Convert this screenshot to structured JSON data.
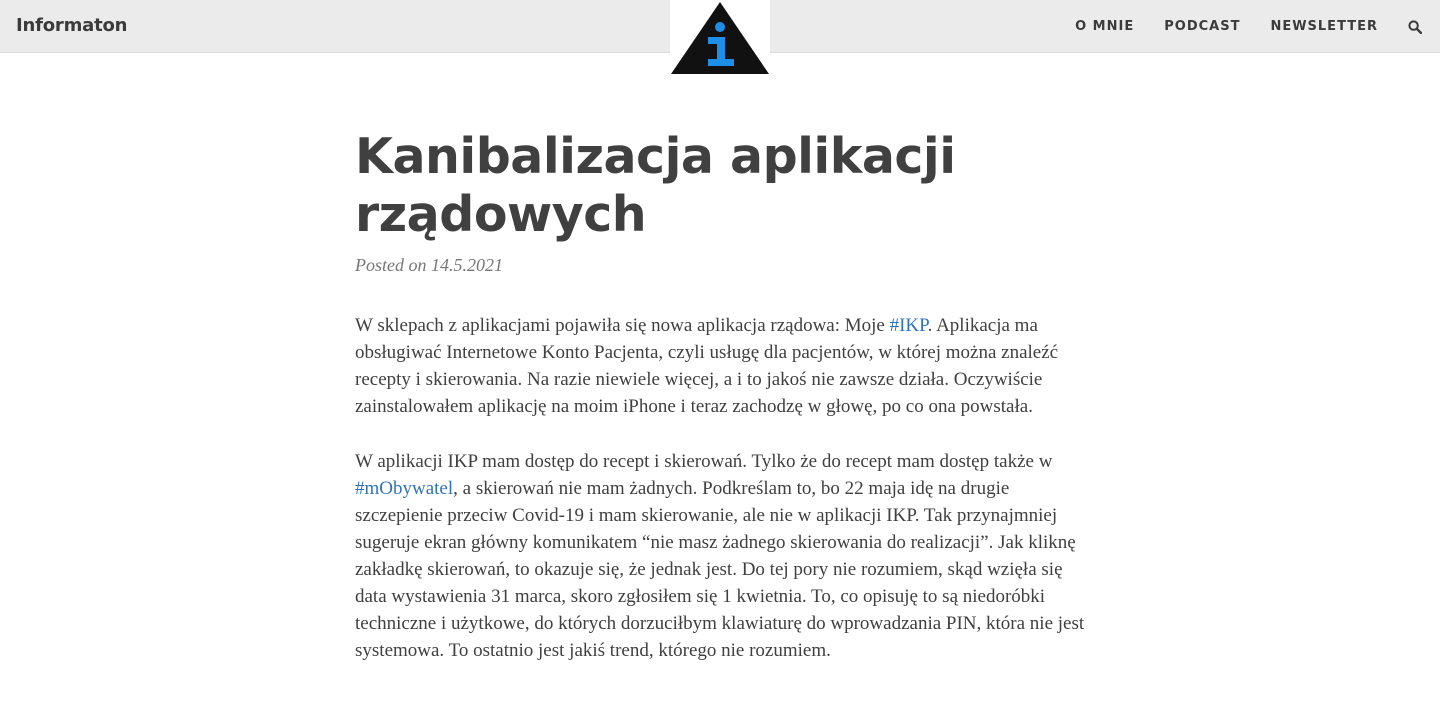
{
  "site": {
    "title": "Informaton"
  },
  "nav": {
    "items": [
      "O MNIE",
      "PODCAST",
      "NEWSLETTER"
    ],
    "search_icon": "search-icon"
  },
  "logo": {
    "icon": "info-triangle-icon",
    "colors": {
      "triangle": "#111111",
      "letter": "#1d8fe8"
    }
  },
  "post": {
    "title_line1": "Kanibalizacja aplikacji",
    "title_line2": "rządowych",
    "meta_prefix": "Posted on",
    "date": "14.5.2021",
    "p1": {
      "before": "W sklepach z aplikacjami pojawiła się nowa aplikacja rządowa: Moje ",
      "link": "#IKP",
      "after": ". Aplikacja ma obsługiwać Internetowe Konto Pacjenta, czyli usługę dla pacjentów, w której można znaleźć recepty i skierowania. Na razie niewiele więcej, a i to jakoś nie zawsze działa. Oczywiście zainstalowałem aplikację na moim iPhone i teraz zachodzę w głowę, po co ona powstała."
    },
    "p2": {
      "before": "W aplikacji IKP mam dostęp do recept i skierowań. Tylko że do recept mam dostęp także w ",
      "link": "#mObywatel",
      "after": ", a skierowań nie mam żadnych. Podkreślam to, bo 22 maja idę na drugie szczepienie przeciw Covid-19 i mam skierowanie, ale nie w aplikacji IKP. Tak przynajmniej sugeruje ekran główny komunikatem “nie masz żadnego skierowania do realizacji”. Jak kliknę zakładkę skierowań, to okazuje się, że jednak jest. Do tej pory nie rozumiem, skąd wzięła się data wystawienia 31 marca, skoro zgłosiłem się 1 kwietnia. To, co opisuję to są niedoróbki techniczne i użytkowe, do których dorzuciłbym klawiaturę do wprowadzania PIN, która nie jest systemowa. To ostatnio jest jakiś trend, którego nie rozumiem."
    }
  },
  "colors": {
    "topbar": "#ebebeb",
    "link": "#2f73c0",
    "text": "#404040",
    "meta": "#777777"
  }
}
